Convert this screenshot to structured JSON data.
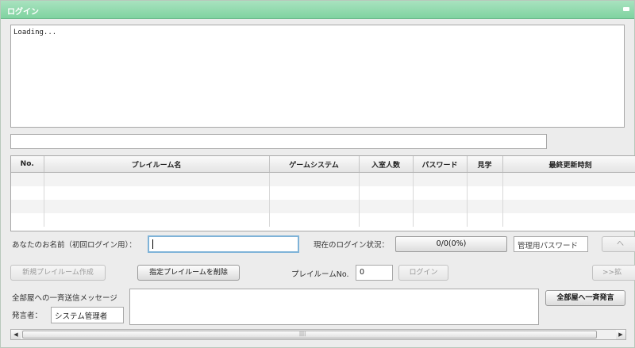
{
  "window": {
    "title": "ログイン"
  },
  "log": {
    "text": "Loading..."
  },
  "chat": {
    "value": ""
  },
  "table": {
    "columns": [
      "No.",
      "プレイルーム名",
      "ゲームシステム",
      "入室人数",
      "パスワード",
      "見学",
      "最終更新時刻"
    ],
    "rows": [
      [
        "",
        "",
        "",
        "",
        "",
        "",
        ""
      ],
      [
        "",
        "",
        "",
        "",
        "",
        "",
        ""
      ],
      [
        "",
        "",
        "",
        "",
        "",
        "",
        ""
      ],
      [
        "",
        "",
        "",
        "",
        "",
        "",
        ""
      ]
    ]
  },
  "login_row": {
    "name_label": "あなたのお名前（初回ログイン用）：",
    "name_value": "",
    "status_label": "現在のログイン状況：",
    "status_value": "0/0(0%)",
    "admin_password_placeholder": "管理用パスワード",
    "next_button": "へ"
  },
  "room_row": {
    "create_button": "新規プレイルーム作成",
    "delete_button": "指定プレイルームを削除",
    "room_no_label": "プレイルームNo.",
    "room_no_value": "0",
    "login_button": "ログイン",
    "extend_button": ">>拡"
  },
  "broadcast": {
    "title_label": "全部屋への一斉送信メッセージ",
    "sender_label": "発言者：",
    "sender_value": "システム管理者",
    "message_value": "",
    "send_button": "全部屋へ一斉発言"
  },
  "scrollbar": {
    "left_arrow": "◀",
    "right_arrow": "▶",
    "grip": "||||"
  }
}
